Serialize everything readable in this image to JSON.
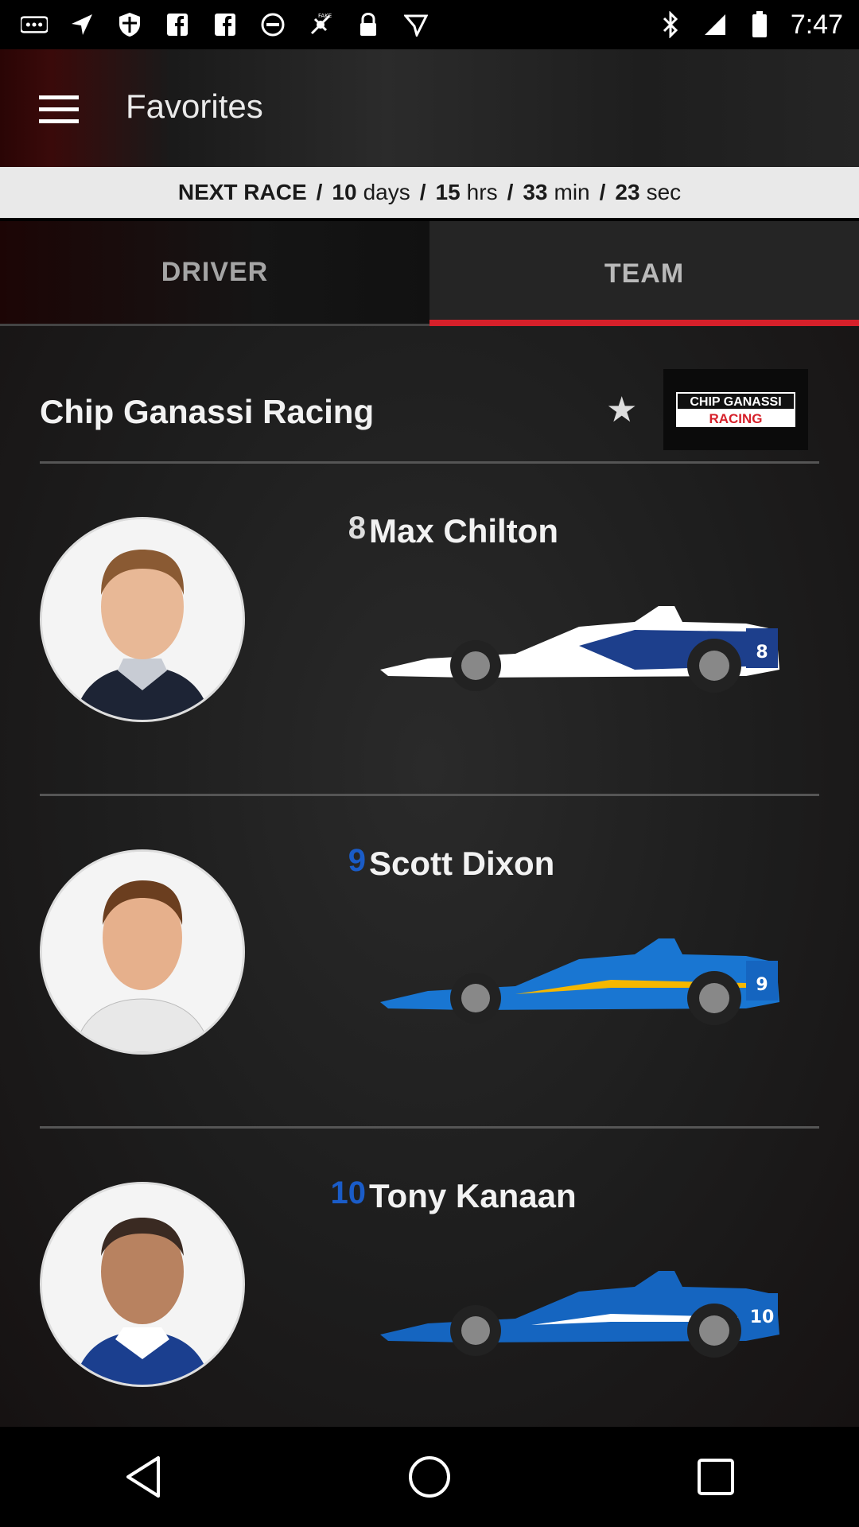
{
  "status_bar": {
    "time": "7:47",
    "icons": [
      "more-notifications-icon",
      "navigation-icon",
      "shield-icon",
      "facebook-icon",
      "facebook-icon",
      "blocked-icon",
      "fake-gps-icon",
      "lock-icon",
      "location-icon",
      "bluetooth-icon",
      "signal-icon",
      "battery-icon"
    ]
  },
  "app_bar": {
    "title": "Favorites",
    "menu_icon": "menu-icon"
  },
  "countdown": {
    "label": "NEXT RACE",
    "days_value": "10",
    "days_unit": "days",
    "hrs_value": "15",
    "hrs_unit": "hrs",
    "min_value": "33",
    "min_unit": "min",
    "sec_value": "23",
    "sec_unit": "sec",
    "separator": "/"
  },
  "tabs": [
    {
      "label": "DRIVER",
      "selected": false
    },
    {
      "label": "TEAM",
      "selected": true
    }
  ],
  "team": {
    "name": "Chip Ganassi Racing",
    "star": "★",
    "logo_text_top": "CHIP GANASSI",
    "logo_text_bottom": "RACING"
  },
  "drivers": [
    {
      "number": "8",
      "name": "Max Chilton",
      "number_color": "#dddddd",
      "car_colors": {
        "body": "#ffffff",
        "accent": "#1d3f8c"
      }
    },
    {
      "number": "9",
      "name": "Scott Dixon",
      "number_color": "#1a5cc8",
      "car_colors": {
        "body": "#1976d2",
        "accent": "#f5b700"
      }
    },
    {
      "number": "10",
      "name": "Tony Kanaan",
      "number_color": "#1a5cc8",
      "car_colors": {
        "body": "#1565c0",
        "accent": "#ffffff"
      }
    }
  ],
  "colors": {
    "accent_red": "#d6202a"
  },
  "nav_bar": {
    "icons": [
      "back-icon",
      "home-icon",
      "recents-icon"
    ]
  }
}
